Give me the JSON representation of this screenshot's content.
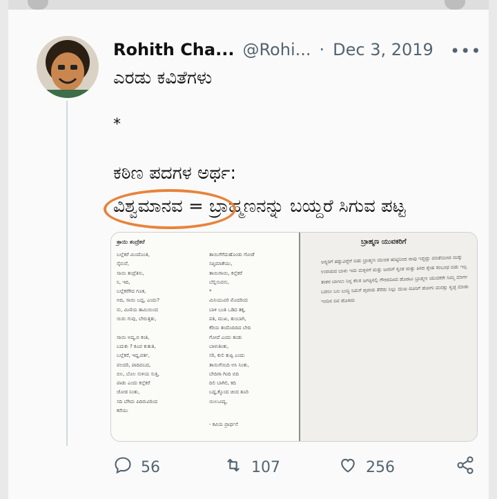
{
  "tweet": {
    "author_name": "Rohith Cha...",
    "handle": "@Rohi...",
    "separator": "·",
    "date": "Dec 3, 2019",
    "more": "•••",
    "lines": [
      "ಎರಡು ಕವಿತೆಗಳು",
      "*",
      "ಕಠಿಣ ಪದಗಳ ಅರ್ಥ:",
      "ವಿಶ್ವಮಾನವ = ಬ್ರಾಹ್ಮಣನನ್ನು ಬಯ್ದರೆ ಸಿಗುವ ಪಟ್ಟ"
    ]
  },
  "media": {
    "left_heading": "ತ್ರಾಯಿ ತಂದ್ರೆಕರೆ",
    "right_heading": "ಬ್ರಾಹ್ಮಣ ಯುವಕರಿಗೆ",
    "footer": "- ಕವಿಯ ಪ್ರಾರ್ಥನೆ"
  },
  "actions": {
    "reply_count": "56",
    "retweet_count": "107",
    "like_count": "256"
  },
  "colors": {
    "highlight_circle": "#e8833a",
    "muted": "#536471"
  }
}
